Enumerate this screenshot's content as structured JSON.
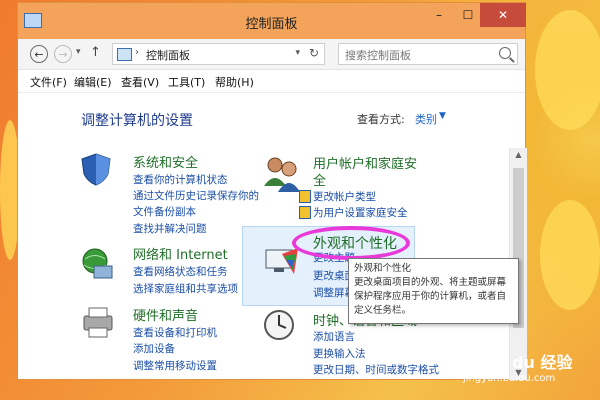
{
  "window": {
    "title": "控制面板",
    "min_label": "–",
    "max_label": "☐",
    "close_label": "✕"
  },
  "address_bar": {
    "back_label": "←",
    "forward_label": "→",
    "up_label": "↑",
    "path": "控制面板",
    "search_placeholder": "搜索控制面板"
  },
  "menu": [
    "文件(F)",
    "编辑(E)",
    "查看(V)",
    "工具(T)",
    "帮助(H)"
  ],
  "content": {
    "heading": "调整计算机的设置",
    "view_by_label": "查看方式:",
    "view_by_value": "类别"
  },
  "categories": {
    "system_security": {
      "title": "系统和安全",
      "links": [
        "查看你的计算机状态",
        "通过文件历史记录保存你的",
        "文件备份副本",
        "查找并解决问题"
      ]
    },
    "network": {
      "title": "网络和 Internet",
      "links": [
        "查看网络状态和任务",
        "选择家庭组和共享选项"
      ]
    },
    "hardware": {
      "title": "硬件和声音",
      "links": [
        "查看设备和打印机",
        "添加设备",
        "调整常用移动设置"
      ]
    },
    "user_accounts": {
      "title_line1": "用户帐户和家庭安",
      "title_line2": "全",
      "links": [
        "更改帐户类型",
        "为用户设置家庭安全"
      ]
    },
    "appearance": {
      "title": "外观和个性化",
      "links": [
        "更改主题",
        "更改桌面背景",
        "调整屏幕分辨率"
      ]
    },
    "clock": {
      "title": "时钟、语言和区域",
      "links": [
        "添加语言",
        "更换输入法",
        "更改日期、时间或数字格式"
      ]
    }
  },
  "tooltip": {
    "lines": [
      "外观和个性化",
      "更改桌面项目的外观、将主题或屏幕",
      "保护程序应用于你的计算机，或者自",
      "定义任务栏。"
    ]
  },
  "watermark": {
    "logo": "Bai du 经验",
    "url": "jingyan.baidu.com"
  },
  "colors": {
    "titlebar": "#f3a45a",
    "close_button": "#c74b3a",
    "link": "#1a4ea8",
    "category_title": "#1f6e28",
    "highlight_circle": "#e93ad9"
  }
}
